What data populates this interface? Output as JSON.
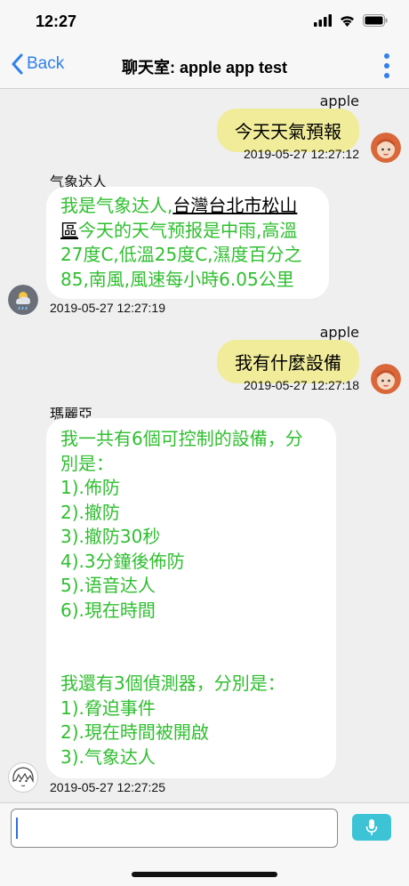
{
  "status": {
    "time": "12:27"
  },
  "nav": {
    "back_label": "Back",
    "title": "聊天室: apple app test"
  },
  "messages": [
    {
      "sender": "apple",
      "text": "今天天氣預報",
      "time": "2019-05-27 12:27:12"
    },
    {
      "sender": "气象达人",
      "text_prefix": "我是气象达人,",
      "text_link": "台灣台北市松山區",
      "text_suffix": "今天的天气预报是中雨,高溫27度C,低溫25度C,濕度百分之85,南風,風速每小時6.05公里",
      "time": "2019-05-27 12:27:19"
    },
    {
      "sender": "apple",
      "text": "我有什麼設備",
      "time": "2019-05-27 12:27:18"
    },
    {
      "sender": "瑪麗亞",
      "lines": [
        "我一共有6個可控制的設備，分",
        "別是：",
        "1).佈防",
        "2).撤防",
        "3).撤防30秒",
        "4).3分鐘後佈防",
        "5).语音达人",
        "6).現在時間",
        "",
        "",
        "我還有3個偵測器，分別是：",
        "1).脅迫事件",
        "2).現在時間被開啟",
        "3).气象达人"
      ],
      "time": "2019-05-27 12:27:25"
    }
  ],
  "input": {
    "value": "",
    "placeholder": ""
  },
  "colors": {
    "accent": "#2f80ed",
    "out_bubble": "#f0ec9a",
    "in_text": "#2fbf2f",
    "mic": "#3cc3d6"
  }
}
